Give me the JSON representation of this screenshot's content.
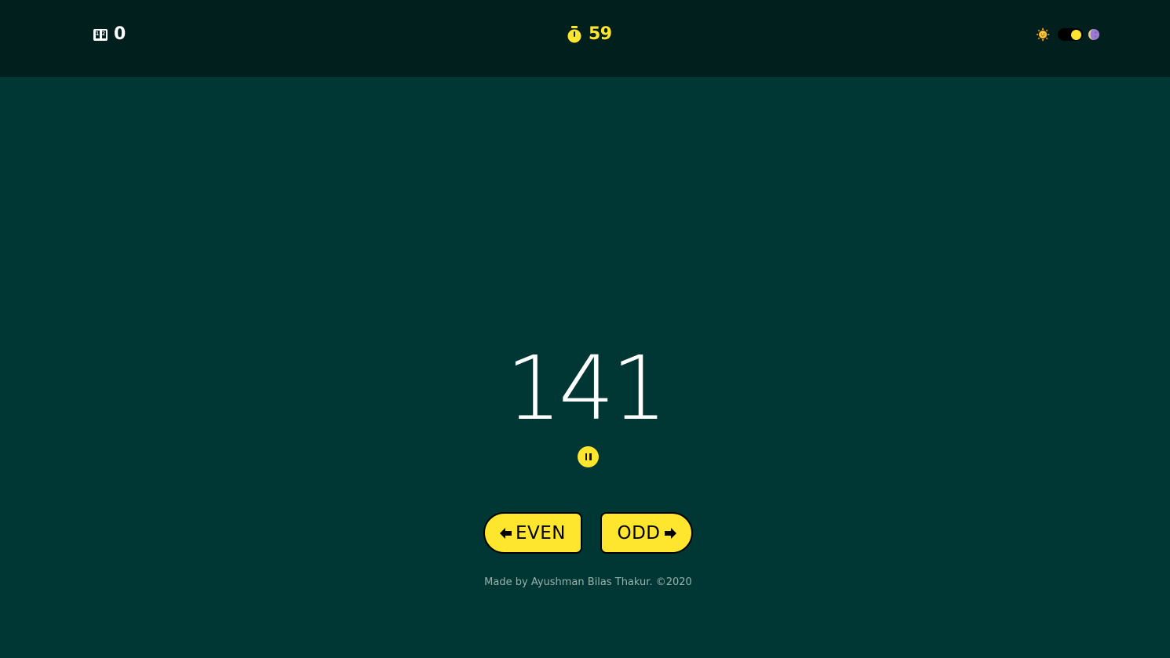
{
  "header": {
    "score_icon": "scoreboard-icon",
    "score_icon_digits": [
      "1",
      "2"
    ],
    "score": "0",
    "timer_icon": "stopwatch-icon",
    "timer": "59",
    "theme_light_icon": "sun-icon",
    "theme_dark_icon": "moon-icon",
    "theme_toggle_on": true
  },
  "game": {
    "current_number": "141",
    "pause_icon": "pause-icon"
  },
  "controls": {
    "even_label": "EVEN",
    "odd_label": "ODD",
    "even_icon": "arrow-left-icon",
    "odd_icon": "arrow-right-icon"
  },
  "footer": {
    "credit": "Made by Ayushman Bilas Thakur. ©2020"
  },
  "colors": {
    "background": "#003734",
    "header_background": "#001f1d",
    "accent": "#ffe62e",
    "text": "#ffffff",
    "muted_text": "#9ab2ae"
  }
}
